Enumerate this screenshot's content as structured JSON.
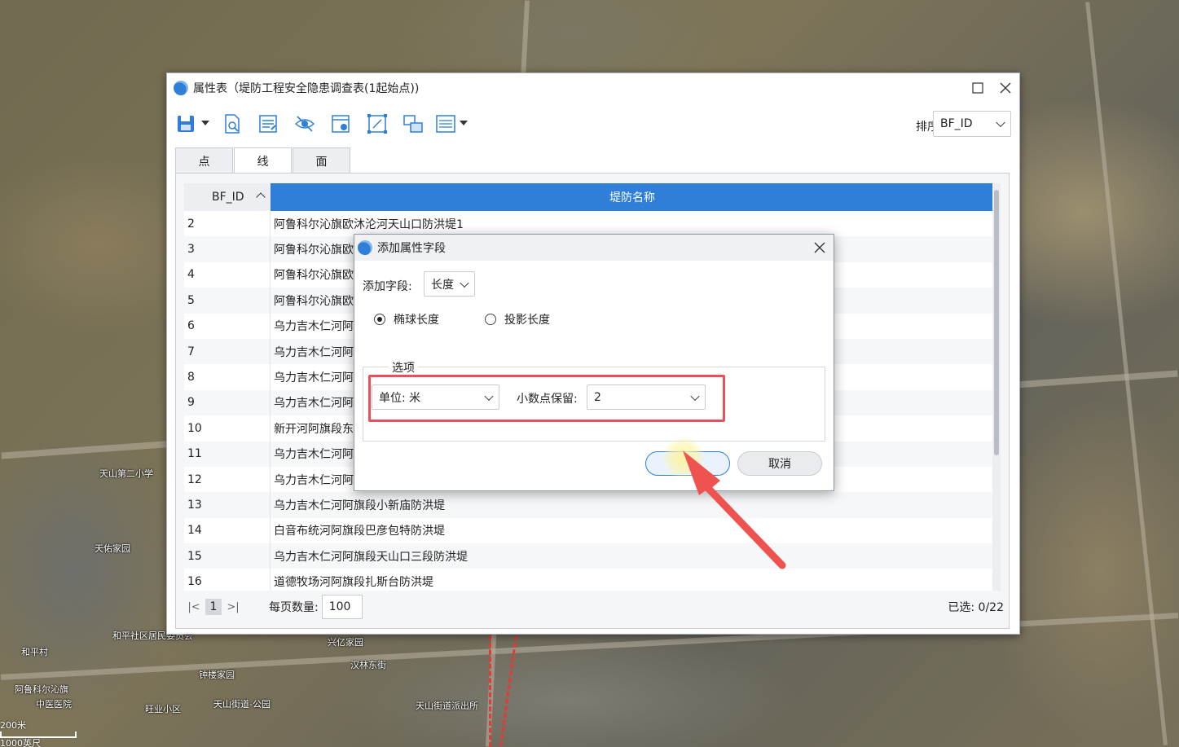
{
  "map": {
    "labels": [
      "天山第二小学",
      "天佑家园",
      "和平社区居民委员会",
      "和平村",
      "阿鲁科尔沁旗",
      "中医医院",
      "钟楼家园",
      "汉林东街",
      "天山街道-公园",
      "旺业小区",
      "天山街道派出所",
      "兴亿家园"
    ],
    "scale": {
      "line1": "200米",
      "line2": "1000英尺"
    },
    "boundary_color": "#e53935"
  },
  "attr_window": {
    "title": "属性表（堤防工程安全隐患调查表(1起始点))",
    "toolbar_icons": [
      "save-icon",
      "zoom-to-icon",
      "edit-attributes-icon",
      "hide-field-icon",
      "field-calculator-icon",
      "select-features-icon",
      "switch-selection-icon",
      "more-list-icon"
    ],
    "sort_label": "排序",
    "sort_value": "BF_ID",
    "tabs": [
      "点",
      "线",
      "面"
    ],
    "active_tab": "线",
    "columns": [
      "BF_ID",
      "堤防名称"
    ],
    "rows": [
      {
        "id": "2",
        "name": "阿鲁科尔沁旗欧沐沦河天山口防洪堤1"
      },
      {
        "id": "3",
        "name": "阿鲁科尔沁旗欧沐"
      },
      {
        "id": "4",
        "name": "阿鲁科尔沁旗欧沐"
      },
      {
        "id": "5",
        "name": "阿鲁科尔沁旗欧沐"
      },
      {
        "id": "6",
        "name": "乌力吉木仁河阿旗"
      },
      {
        "id": "7",
        "name": "乌力吉木仁河阿旗"
      },
      {
        "id": "8",
        "name": "乌力吉木仁河阿旗"
      },
      {
        "id": "9",
        "name": "乌力吉木仁河阿旗"
      },
      {
        "id": "10",
        "name": "新开河阿旗段东侦"
      },
      {
        "id": "11",
        "name": "乌力吉木仁河阿旗"
      },
      {
        "id": "12",
        "name": "乌力吉木仁河阿旗"
      },
      {
        "id": "13",
        "name": "乌力吉木仁河阿旗段小新庙防洪堤"
      },
      {
        "id": "14",
        "name": "白音布统河阿旗段巴彦包特防洪堤"
      },
      {
        "id": "15",
        "name": "乌力吉木仁河阿旗段天山口三段防洪堤"
      },
      {
        "id": "16",
        "name": "道德牧场河阿旗段扎斯台防洪堤"
      }
    ],
    "pager": {
      "first": "|<",
      "page": "1",
      "last": ">|",
      "per_page_label": "每页数量:",
      "per_page_value": "100",
      "selected": "已选: 0/22"
    },
    "accent": "#2f7ed8"
  },
  "dialog": {
    "title": "添加属性字段",
    "add_field_label": "添加字段:",
    "field_value": "长度",
    "radio_ellipsoid": "椭球长度",
    "radio_projected": "投影长度",
    "selected_radio": "椭球长度",
    "options_label": "选项",
    "unit_value": "单位: 米",
    "decimal_label": "小数点保留:",
    "decimal_value": "2",
    "ok_label": "",
    "cancel_label": "取消",
    "highlight_color": "#e8505b"
  }
}
